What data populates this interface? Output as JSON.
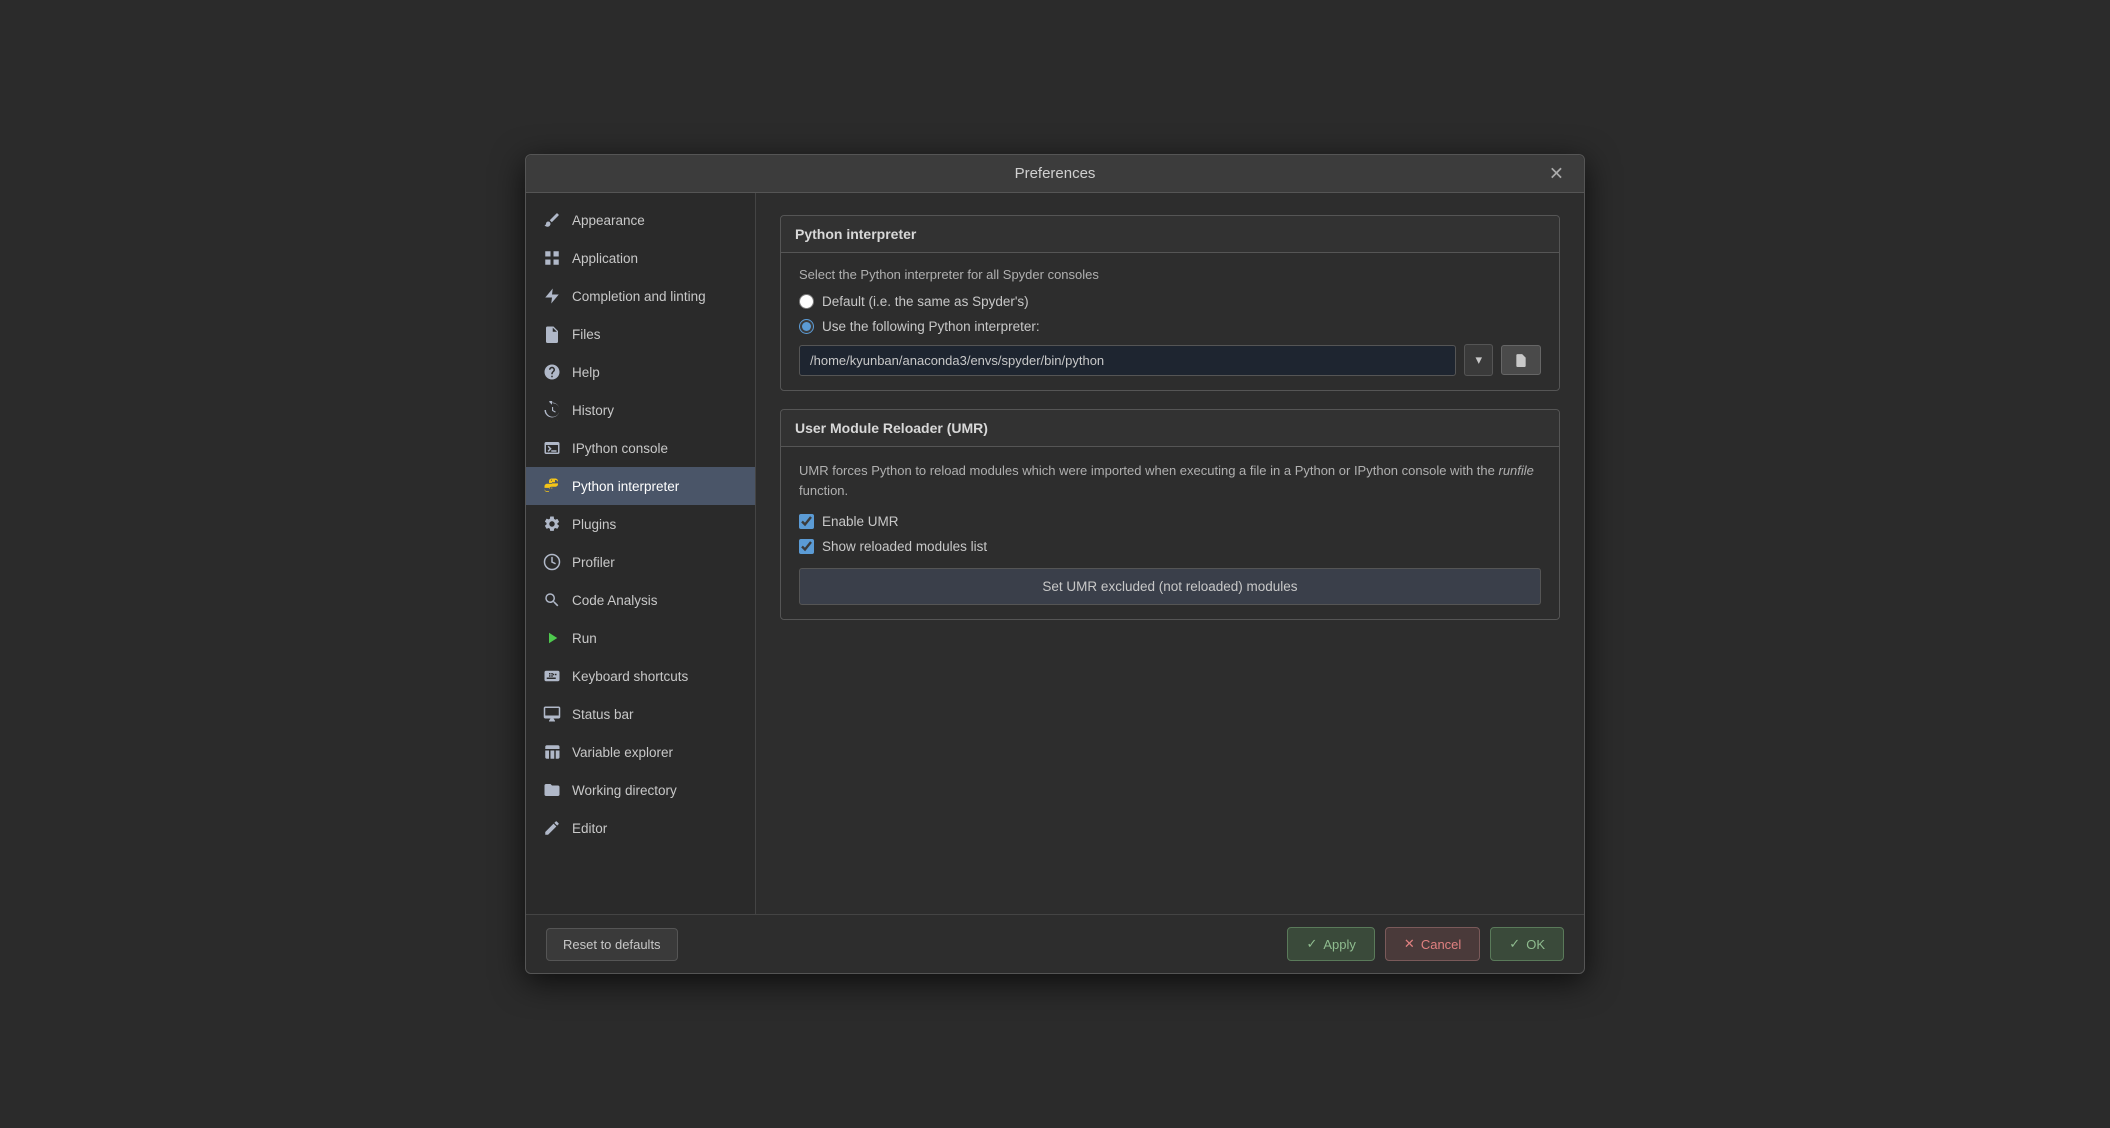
{
  "dialog": {
    "title": "Preferences",
    "close_label": "✕"
  },
  "sidebar": {
    "items": [
      {
        "id": "appearance",
        "label": "Appearance",
        "icon": "brush"
      },
      {
        "id": "application",
        "label": "Application",
        "icon": "grid"
      },
      {
        "id": "completion",
        "label": "Completion and linting",
        "icon": "lightning"
      },
      {
        "id": "files",
        "label": "Files",
        "icon": "files"
      },
      {
        "id": "help",
        "label": "Help",
        "icon": "question"
      },
      {
        "id": "history",
        "label": "History",
        "icon": "clock"
      },
      {
        "id": "ipython",
        "label": "IPython console",
        "icon": "terminal"
      },
      {
        "id": "python-interpreter",
        "label": "Python interpreter",
        "icon": "python",
        "active": true
      },
      {
        "id": "plugins",
        "label": "Plugins",
        "icon": "gear"
      },
      {
        "id": "profiler",
        "label": "Profiler",
        "icon": "clock2"
      },
      {
        "id": "code-analysis",
        "label": "Code Analysis",
        "icon": "search"
      },
      {
        "id": "run",
        "label": "Run",
        "icon": "play"
      },
      {
        "id": "keyboard",
        "label": "Keyboard shortcuts",
        "icon": "keyboard"
      },
      {
        "id": "status-bar",
        "label": "Status bar",
        "icon": "monitor"
      },
      {
        "id": "variable-explorer",
        "label": "Variable explorer",
        "icon": "table"
      },
      {
        "id": "working-directory",
        "label": "Working directory",
        "icon": "folder"
      },
      {
        "id": "editor",
        "label": "Editor",
        "icon": "pencil"
      }
    ]
  },
  "main": {
    "python_interpreter_section": {
      "title": "Python interpreter",
      "description": "Select the Python interpreter for all Spyder consoles",
      "radio_default_label": "Default (i.e. the same as Spyder's)",
      "radio_custom_label": "Use the following Python interpreter:",
      "interpreter_path": "/home/kyunban/anaconda3/envs/spyder/bin/python"
    },
    "umr_section": {
      "title": "User Module Reloader (UMR)",
      "description_part1": "UMR forces Python to reload modules which were imported when executing a file in a Python or IPython console with the ",
      "description_italic": "runfile",
      "description_part2": " function.",
      "enable_umr_label": "Enable UMR",
      "show_reloaded_label": "Show reloaded modules list",
      "set_umr_button": "Set UMR excluded (not reloaded) modules"
    }
  },
  "footer": {
    "reset_label": "Reset to defaults",
    "apply_label": "Apply",
    "cancel_label": "Cancel",
    "ok_label": "OK"
  }
}
